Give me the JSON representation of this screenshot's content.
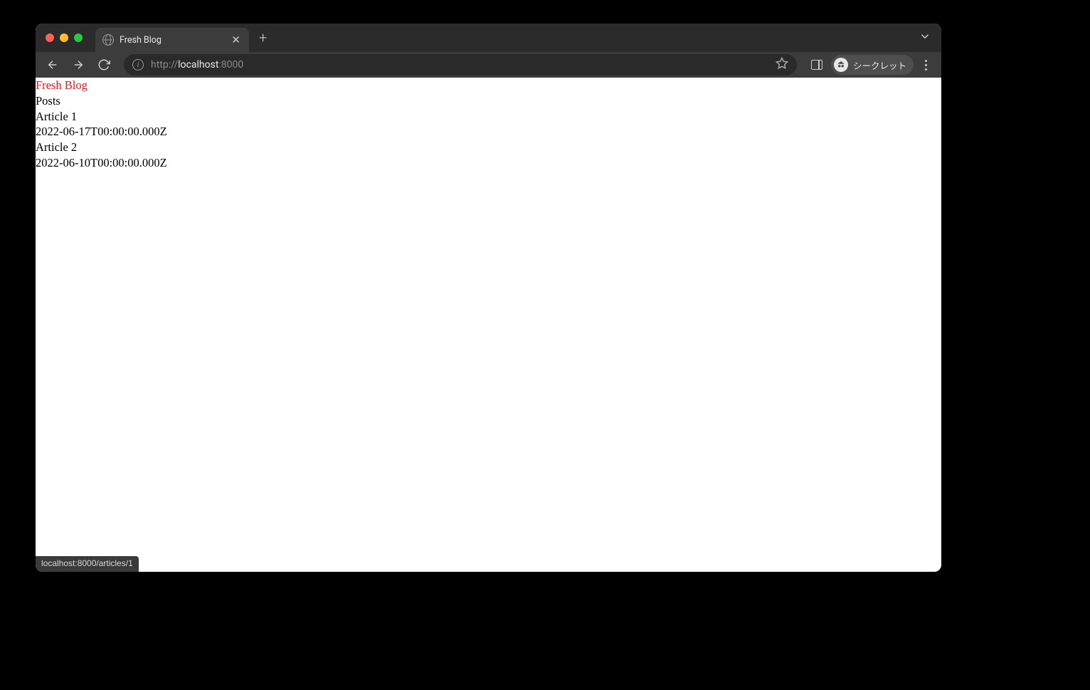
{
  "browser": {
    "tab_title": "Fresh Blog",
    "url_prefix": "http://",
    "url_host": "localhost",
    "url_port": ":8000",
    "incognito_label": "シークレット",
    "status_url": "localhost:8000/articles/1"
  },
  "page": {
    "blog_title": "Fresh Blog",
    "heading": "Posts",
    "articles": [
      {
        "title": "Article 1",
        "date": "2022-06-17T00:00:00.000Z"
      },
      {
        "title": "Article 2",
        "date": "2022-06-10T00:00:00.000Z"
      }
    ]
  }
}
